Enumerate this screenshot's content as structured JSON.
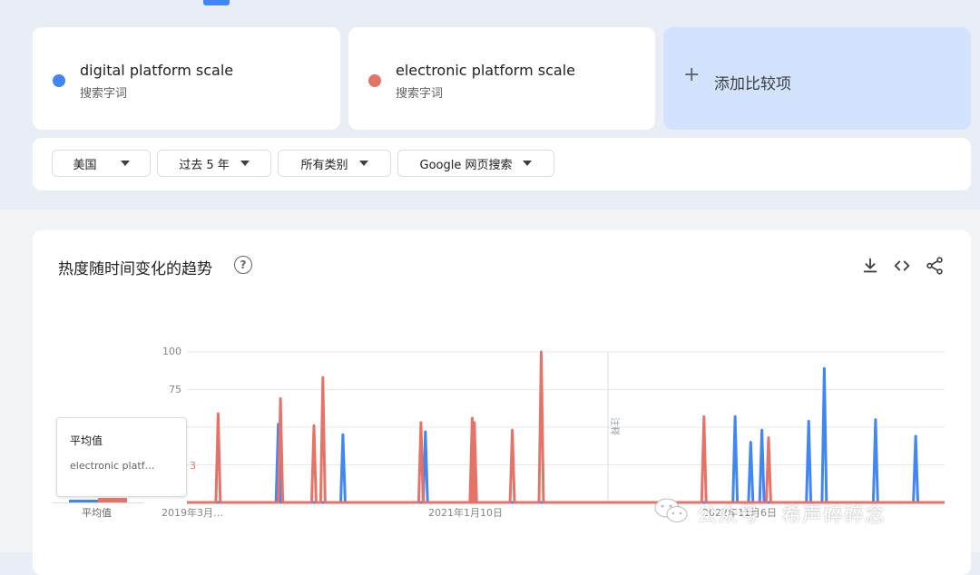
{
  "terms": [
    {
      "label": "digital platform scale",
      "sub": "搜索字词",
      "color": "#4285f4"
    },
    {
      "label": "electronic platform scale",
      "sub": "搜索字词",
      "color": "#e57368"
    }
  ],
  "add_compare": {
    "plus": "+",
    "label": "添加比较项"
  },
  "filters": [
    {
      "label": "美国"
    },
    {
      "label": "过去 5 年"
    },
    {
      "label": "所有类别"
    },
    {
      "label": "Google 网页搜索"
    }
  ],
  "chart_section": {
    "title": "热度随时间变化的趋势",
    "help": "?",
    "icons": [
      "download-icon",
      "embed-code-icon",
      "share-icon"
    ]
  },
  "averages": {
    "title": "平均值",
    "tooltip_term": "electronic platform scale",
    "tooltip_value": "3",
    "label": "平均值",
    "values": [
      {
        "term": "digital platform scale",
        "value": 3
      },
      {
        "term": "electronic platform scale",
        "value": 3
      }
    ]
  },
  "chart_data": {
    "type": "line",
    "ylim": [
      0,
      100
    ],
    "y_ticks": [
      100,
      75,
      50,
      25
    ],
    "y_tick_labels": [
      "100",
      "75",
      "",
      ""
    ],
    "x_tick_labels": [
      "2019年3月…",
      "2021年1月10日",
      "2022年11月6日"
    ],
    "annotation": "注释",
    "grid": true,
    "series": [
      {
        "name": "digital platform scale",
        "color": "#4285f4",
        "spikes": [
          {
            "week": 41,
            "value": 52
          },
          {
            "week": 70,
            "value": 45
          },
          {
            "week": 107,
            "value": 47
          },
          {
            "week": 246,
            "value": 57
          },
          {
            "week": 253,
            "value": 40
          },
          {
            "week": 258,
            "value": 48
          },
          {
            "week": 279,
            "value": 54
          },
          {
            "week": 286,
            "value": 89
          },
          {
            "week": 309,
            "value": 55
          },
          {
            "week": 327,
            "value": 44
          }
        ]
      },
      {
        "name": "electronic platform scale",
        "color": "#e57368",
        "spikes": [
          {
            "week": 14,
            "value": 59
          },
          {
            "week": 42,
            "value": 69
          },
          {
            "week": 57,
            "value": 51
          },
          {
            "week": 61,
            "value": 83
          },
          {
            "week": 105,
            "value": 53
          },
          {
            "week": 128,
            "value": 56
          },
          {
            "week": 129,
            "value": 53
          },
          {
            "week": 146,
            "value": 48
          },
          {
            "week": 159,
            "value": 100
          },
          {
            "week": 232,
            "value": 57
          },
          {
            "week": 261,
            "value": 43
          }
        ]
      }
    ]
  },
  "watermark": "公众号 · 希声碎碎念"
}
